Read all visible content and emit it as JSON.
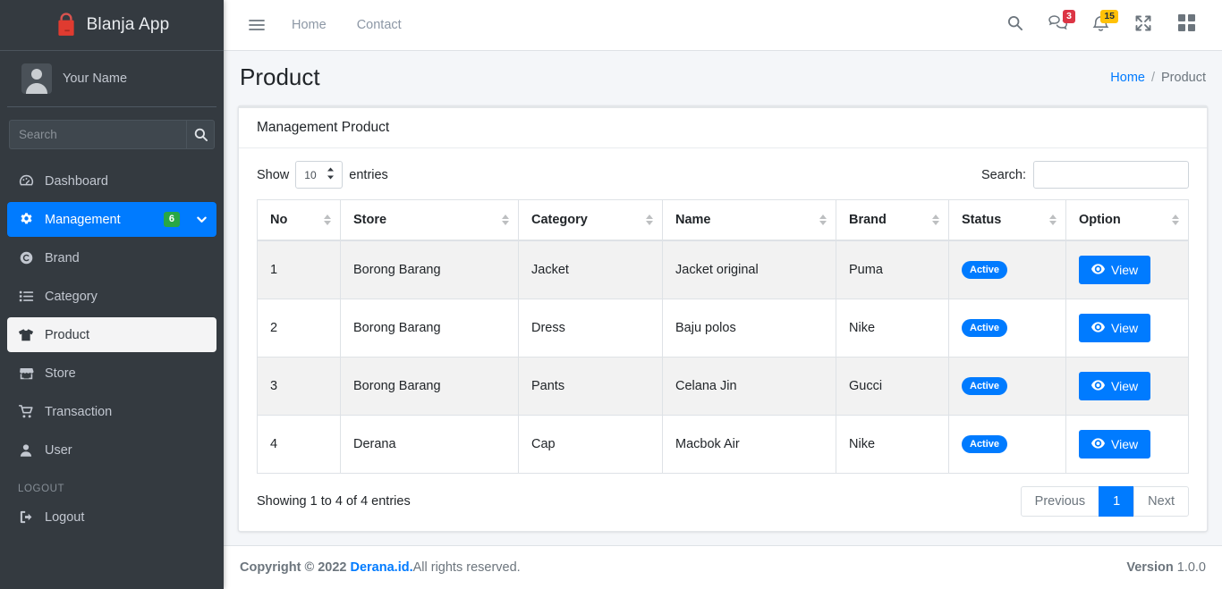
{
  "sidebar": {
    "brand": {
      "title": "Blanja App",
      "icon": "shopping-bag-icon"
    },
    "user": {
      "name": "Your Name"
    },
    "search": {
      "placeholder": "Search",
      "value": "",
      "button_icon": "search-icon"
    },
    "items": [
      {
        "label": "Dashboard",
        "icon": "tachometer-icon",
        "state": "default",
        "badge": null
      },
      {
        "label": "Management",
        "icon": "gear-icon",
        "state": "active-blue",
        "badge": "6",
        "chevron": "chevron-down-icon"
      },
      {
        "label": "Brand",
        "icon": "copyright-icon",
        "state": "default",
        "badge": null
      },
      {
        "label": "Category",
        "icon": "list-icon",
        "state": "default",
        "badge": null
      },
      {
        "label": "Product",
        "icon": "tshirt-icon",
        "state": "active-light",
        "badge": null
      },
      {
        "label": "Store",
        "icon": "store-icon",
        "state": "default",
        "badge": null
      },
      {
        "label": "Transaction",
        "icon": "shopping-cart-icon",
        "state": "default",
        "badge": null
      },
      {
        "label": "User",
        "icon": "user-icon",
        "state": "default",
        "badge": null
      }
    ],
    "logout_header": "LOGOUT",
    "logout_item": {
      "label": "Logout",
      "icon": "sign-out-icon"
    }
  },
  "navbar": {
    "toggle_icon": "hamburger-menu-icon",
    "links": [
      {
        "label": "Home"
      },
      {
        "label": "Contact"
      }
    ],
    "icons": [
      {
        "name": "search-icon",
        "badge": null
      },
      {
        "name": "comments-icon",
        "badge": "3",
        "badge_color": "#dc3545"
      },
      {
        "name": "bell-icon",
        "badge": "15",
        "badge_color": "#ffc107"
      },
      {
        "name": "expand-arrows-icon",
        "badge": null
      },
      {
        "name": "grid-icon",
        "badge": null
      }
    ]
  },
  "content_header": {
    "title": "Product",
    "breadcrumb": {
      "home": "Home",
      "separator": "/",
      "current": "Product"
    }
  },
  "card": {
    "header": "Management Product",
    "length_menu": {
      "prefix": "Show",
      "value": "10",
      "suffix": "entries"
    },
    "filter": {
      "label": "Search:",
      "value": "",
      "placeholder": ""
    },
    "columns": [
      "No",
      "Store",
      "Category",
      "Name",
      "Brand",
      "Status",
      "Option"
    ],
    "rows": [
      {
        "no": "1",
        "store": "Borong Barang",
        "category": "Jacket",
        "name": "Jacket original",
        "brand": "Puma",
        "status": "Active",
        "option": "View"
      },
      {
        "no": "2",
        "store": "Borong Barang",
        "category": "Dress",
        "name": "Baju polos",
        "brand": "Nike",
        "status": "Active",
        "option": "View"
      },
      {
        "no": "3",
        "store": "Borong Barang",
        "category": "Pants",
        "name": "Celana Jin",
        "brand": "Gucci",
        "status": "Active",
        "option": "View"
      },
      {
        "no": "4",
        "store": "Derana",
        "category": "Cap",
        "name": "Macbok Air",
        "brand": "Nike",
        "status": "Active",
        "option": "View"
      }
    ],
    "info": "Showing 1 to 4 of 4 entries",
    "pagination": {
      "previous": "Previous",
      "pages": [
        "1"
      ],
      "next": "Next",
      "current": "1"
    }
  },
  "footer": {
    "copyright_prefix": "Copyright © 2022 ",
    "brand": "Derana.id.",
    "copyright_suffix": "All rights reserved.",
    "version_label": "Version",
    "version_value": "1.0.0"
  },
  "colors": {
    "accent": "#007bff",
    "sidebar_bg": "#343a40",
    "badge_green": "#28a745",
    "badge_red": "#dc3545",
    "badge_yellow": "#ffc107"
  }
}
